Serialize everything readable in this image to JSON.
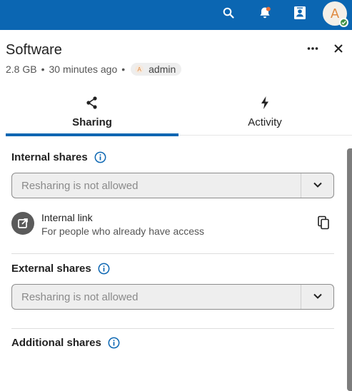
{
  "topbar": {
    "icons": [
      "search-icon",
      "notifications-icon",
      "contacts-icon"
    ],
    "user_avatar_initial": "A",
    "status": "online"
  },
  "sidebar": {
    "title": "Software",
    "size": "2.8 GB",
    "modified": "30 minutes ago",
    "owner_initial": "A",
    "owner": "admin",
    "menu_icon": "more-icon",
    "close_icon": "close-icon"
  },
  "tabs": [
    {
      "label": "Sharing",
      "icon": "share-icon",
      "active": true
    },
    {
      "label": "Activity",
      "icon": "activity-icon",
      "active": false
    }
  ],
  "sharing": {
    "internal": {
      "title": "Internal shares",
      "select_value": "Resharing is not allowed"
    },
    "internal_link": {
      "title": "Internal link",
      "subtitle": "For people who already have access"
    },
    "external": {
      "title": "External shares",
      "select_value": "Resharing is not allowed"
    },
    "additional": {
      "title": "Additional shares"
    }
  },
  "colors": {
    "primary": "#0b66b2",
    "status_online": "#3f9145",
    "avatar_text": "#e0893f"
  }
}
